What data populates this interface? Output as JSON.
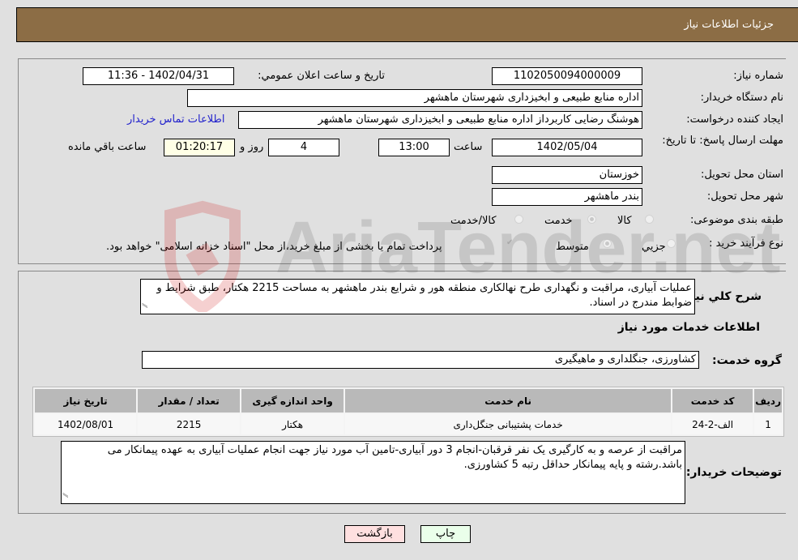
{
  "header": {
    "title": "جزئیات اطلاعات نیاز"
  },
  "form": {
    "need_number": {
      "label": "شماره نیاز:",
      "value": "1102050094000009"
    },
    "announce_datetime": {
      "label": "تاریخ و ساعت اعلان عمومي:",
      "value": "1402/04/31 - 11:36"
    },
    "buyer_org": {
      "label": "نام دستگاه خريدار:",
      "value": "اداره منابع طبیعی و ابخیزداری شهرستان ماهشهر"
    },
    "requester": {
      "label": "ایجاد کننده درخواست:",
      "value": "هوشنگ رضایی کاربرداز اداره منابع طبیعی و ابخیزداری شهرستان ماهشهر"
    },
    "buyer_contact_link": "اطلاعات تماس خريدار",
    "deadline": {
      "label": "مهلت ارسال پاسخ: تا تاریخ:",
      "date": "1402/05/04",
      "time_label": "ساعت",
      "time": "13:00",
      "days": "4",
      "days_label": "روز و",
      "remaining": "01:20:17",
      "remaining_label": "ساعت باقي مانده"
    },
    "province": {
      "label": "استان محل تحویل:",
      "value": "خوزستان"
    },
    "city": {
      "label": "شهر محل تحویل:",
      "value": "بندر ماهشهر"
    },
    "category": {
      "label": "طبقه بندی موضوعی:",
      "options": [
        "کالا",
        "خدمت",
        "کالا/خدمت"
      ],
      "selected": "خدمت"
    },
    "purchase_type": {
      "label": "نوع فرآیند خرید :",
      "options": [
        "جزيي",
        "متوسط"
      ],
      "selected": "متوسط",
      "payment_note": "پرداخت تمام یا بخشی از مبلغ خرید،از محل \"اسناد خزانه اسلامی\" خواهد بود."
    }
  },
  "description": {
    "label": "شرح کلي نياز:",
    "value": "عملیات آبیاری، مراقبت و نگهداری طرح نهالکاری منطقه هور و شرایع بندر ماهشهر به مساحت 2215 هکتار، طبق شرایط و ضوابط مندرج در اسناد."
  },
  "services": {
    "section_title": "اطلاعات خدمات مورد نياز",
    "group_label": "گروه خدمت:",
    "group_value": "کشاورزی، جنگلداری و ماهیگیری",
    "columns": [
      "رديف",
      "کد خدمت",
      "نام خدمت",
      "واحد اندازه گيری",
      "تعداد / مقدار",
      "تاريخ نياز"
    ],
    "rows": [
      [
        "1",
        "الف-2-24",
        "خدمات پشتیبانی جنگل‌داری",
        "هکتار",
        "2215",
        "1402/08/01"
      ]
    ]
  },
  "buyer_notes": {
    "label": "توضيحات خريدار:",
    "value": "مراقبت از عرصه و به کارگیری یک نفر قرقبان-انجام 3 دور آبیاری-تامین آب مورد نیاز جهت انجام عملیات آبیاری به عهده پیمانکار می باشد.رشته و پایه پیمانکار حداقل رتبه 5 کشاورزی."
  },
  "buttons": {
    "print": "چاپ",
    "back": "بازگشت"
  },
  "watermark": {
    "text": "AriaTender.net"
  }
}
